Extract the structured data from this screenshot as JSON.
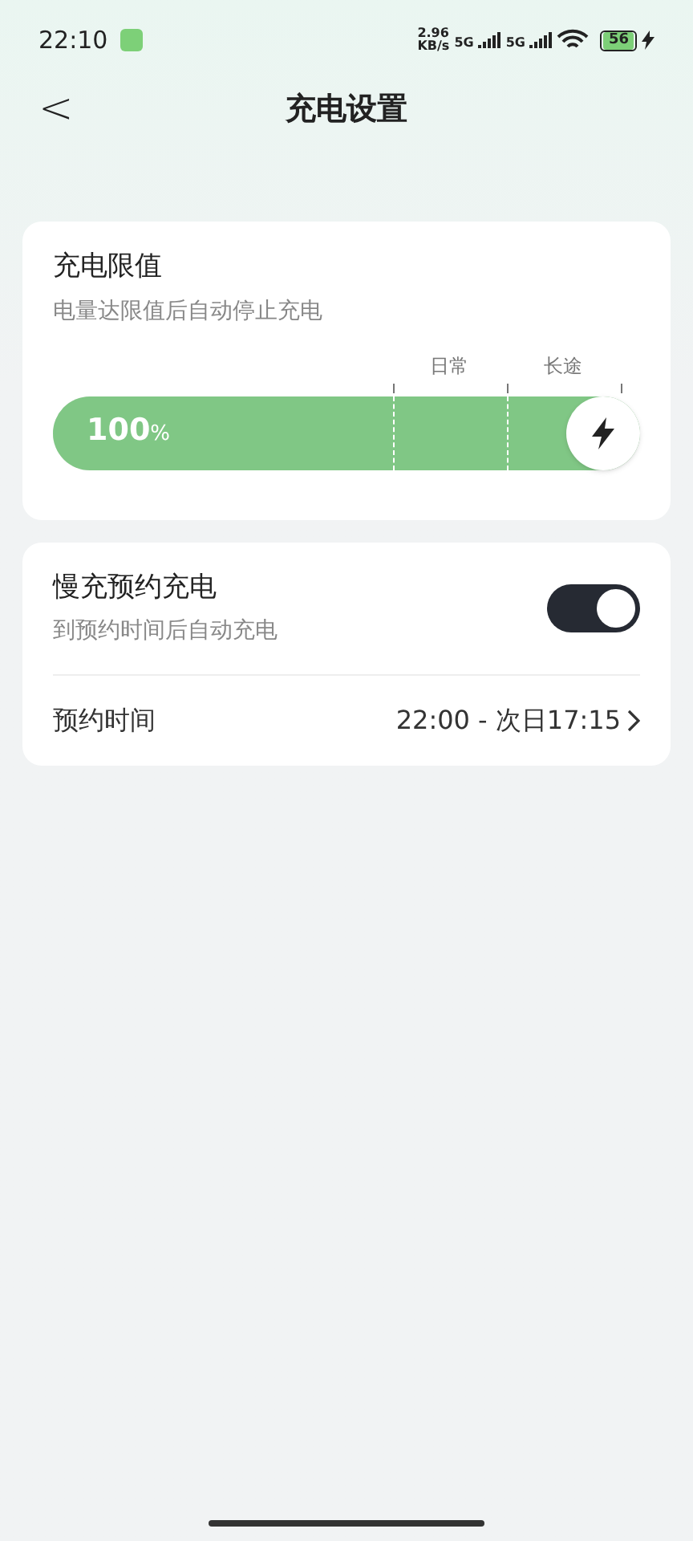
{
  "status_bar": {
    "time": "22:10",
    "speed_value": "2.96",
    "speed_unit": "KB/s",
    "network_1": "5G",
    "network_2": "5G",
    "battery": "56"
  },
  "header": {
    "back": "<",
    "title": "充电设置"
  },
  "charge_limit": {
    "title": "充电限值",
    "subtitle": "电量达限值后自动停止充电",
    "marks": [
      "日常",
      "长途"
    ],
    "level": 1,
    "reading_value": "100",
    "reading_unit": "%"
  },
  "scheduled": {
    "title": "慢充预约充电",
    "subtitle": "到预约时间后自动充电",
    "on": true,
    "time_label": "预约时间",
    "time_value": "22:00 - 次日17:15"
  }
}
